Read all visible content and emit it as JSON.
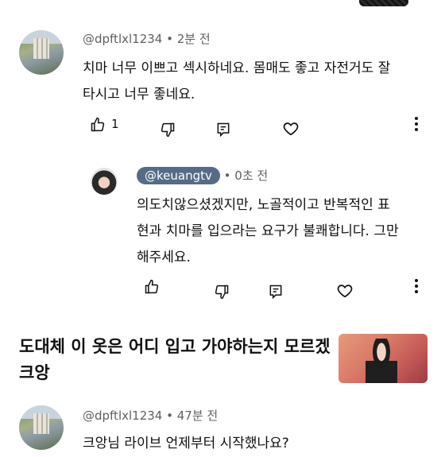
{
  "comments": [
    {
      "handle": "@dpftlxl1234",
      "sep": "•",
      "time": "2분 전",
      "lines": [
        "치마 너무 이쁘고 섹시하네요. 몸매도 좋고 자전거도 잘",
        "타시고 너무 좋네요."
      ],
      "like_count": "1"
    },
    {
      "handle": "@keuangtv",
      "sep": "•",
      "time": "0초 전",
      "lines": [
        "의도치않으셨겠지만, 노골적이고 반복적인 표",
        "현과 치마를 입으라는 요구가 불쾌합니다. 그만",
        "해주세요."
      ]
    }
  ],
  "video": {
    "title_lines": [
      "도대체 이 옷은 어디 입고 가야하는지 모르겠",
      "크앙"
    ]
  },
  "comment3": {
    "handle": "@dpftlxl1234",
    "sep": "•",
    "time": "47분 전",
    "line": "크앙님 라이브 언제부터 시작했나요?"
  },
  "icons": [
    "thumbs-up-icon",
    "thumbs-down-icon",
    "reply-icon",
    "heart-icon",
    "more-vertical-icon"
  ],
  "colors": {
    "chip": "#556b86",
    "meta": "#606060",
    "text": "#0f0f0f"
  }
}
